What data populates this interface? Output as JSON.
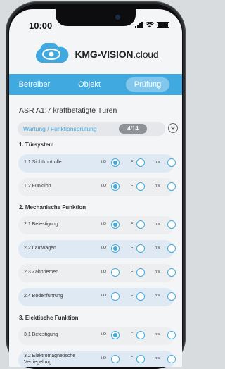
{
  "status": {
    "time": "10:00"
  },
  "brand": {
    "name": "KMG-VISION",
    "suffix": ".cloud"
  },
  "nav": {
    "tabs": [
      "Betreiber",
      "Objekt",
      "Prüfung"
    ],
    "active": "Prüfung"
  },
  "page": {
    "title": "ASR A1:7 kraftbetätigte Türen"
  },
  "section": {
    "label": "Wartung / Funktionsprüfung",
    "progress": "4/14"
  },
  "options": {
    "io": "i.O",
    "f": "F",
    "nv": "n.v."
  },
  "colors": {
    "accent": "#3fa9e0",
    "navbar": "#3fa9e0"
  },
  "groups": [
    {
      "title": "1. Türsystem",
      "items": [
        {
          "label": "1.1 Sichtkontrolle",
          "selected": "io"
        },
        {
          "label": "1.2 Funktion",
          "selected": "io"
        }
      ]
    },
    {
      "title": "2. Mechanische Funktion",
      "items": [
        {
          "label": "2.1 Befestigung",
          "selected": "io"
        },
        {
          "label": "2.2 Laufwagen",
          "selected": "io"
        },
        {
          "label": "2.3 Zahnriemen",
          "selected": "none"
        },
        {
          "label": "2.4 Bodenführung",
          "selected": "none"
        }
      ]
    },
    {
      "title": "3. Elektische Funktion",
      "items": [
        {
          "label": "3.1 Befestigung",
          "selected": "io"
        },
        {
          "label": "3.2 Elektromagnetische Verriegelung",
          "selected": "none"
        }
      ]
    }
  ]
}
